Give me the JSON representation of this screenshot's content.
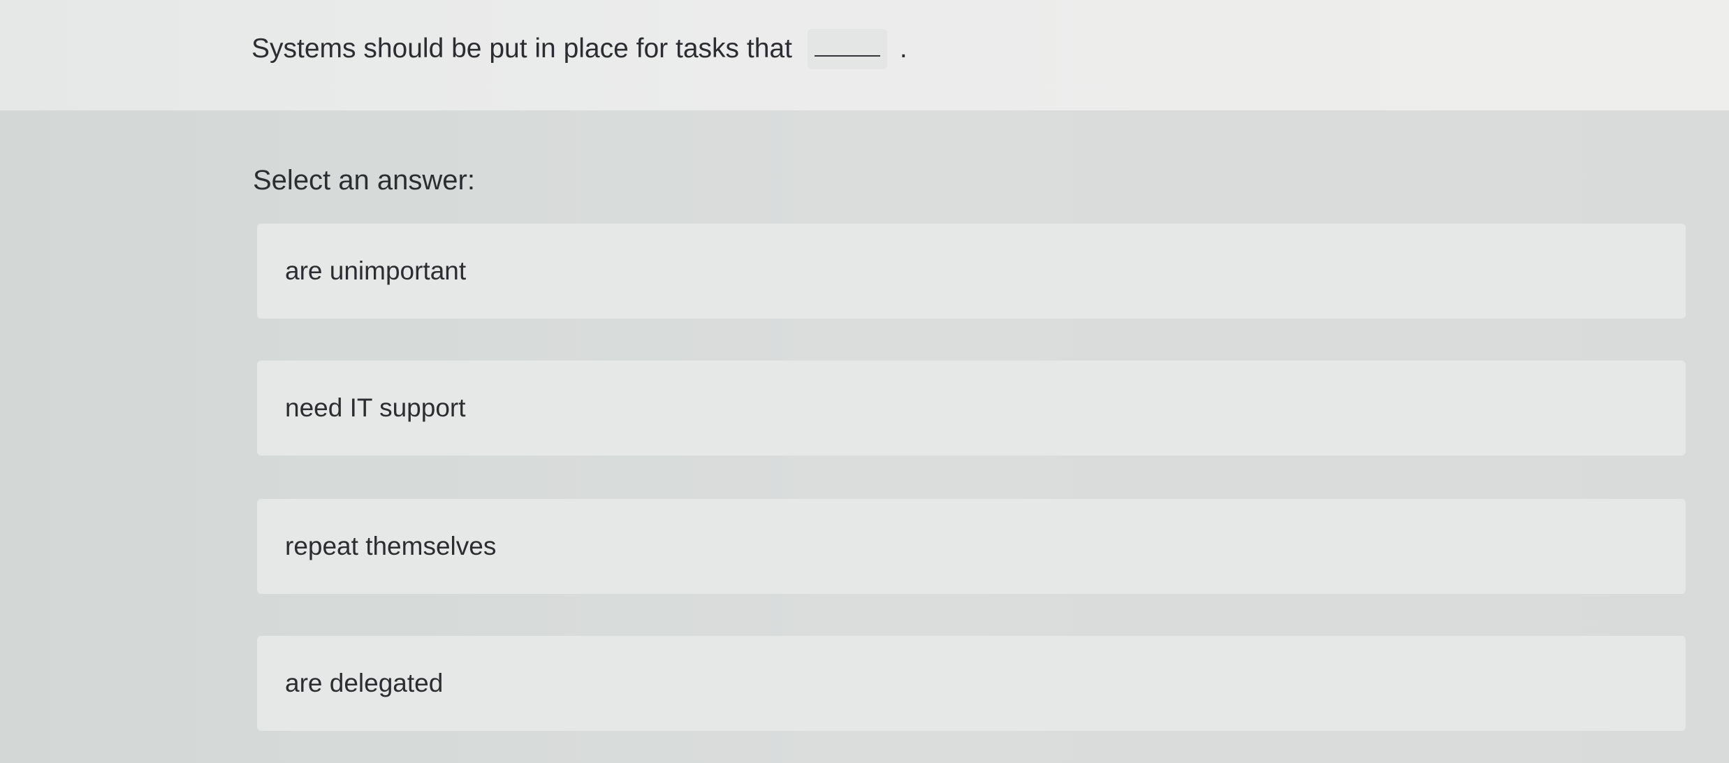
{
  "question": {
    "text": "Systems should be put in place for tasks that",
    "blank": "_____",
    "period": "."
  },
  "prompt": "Select an answer:",
  "options": [
    {
      "label": "are unimportant"
    },
    {
      "label": "need IT support"
    },
    {
      "label": "repeat themselves"
    },
    {
      "label": "are delegated"
    }
  ],
  "colors": {
    "question_band": "#ececec",
    "page_background": "#dadddc",
    "option_background": "#e6e8e7",
    "text": "#2b2d30"
  }
}
